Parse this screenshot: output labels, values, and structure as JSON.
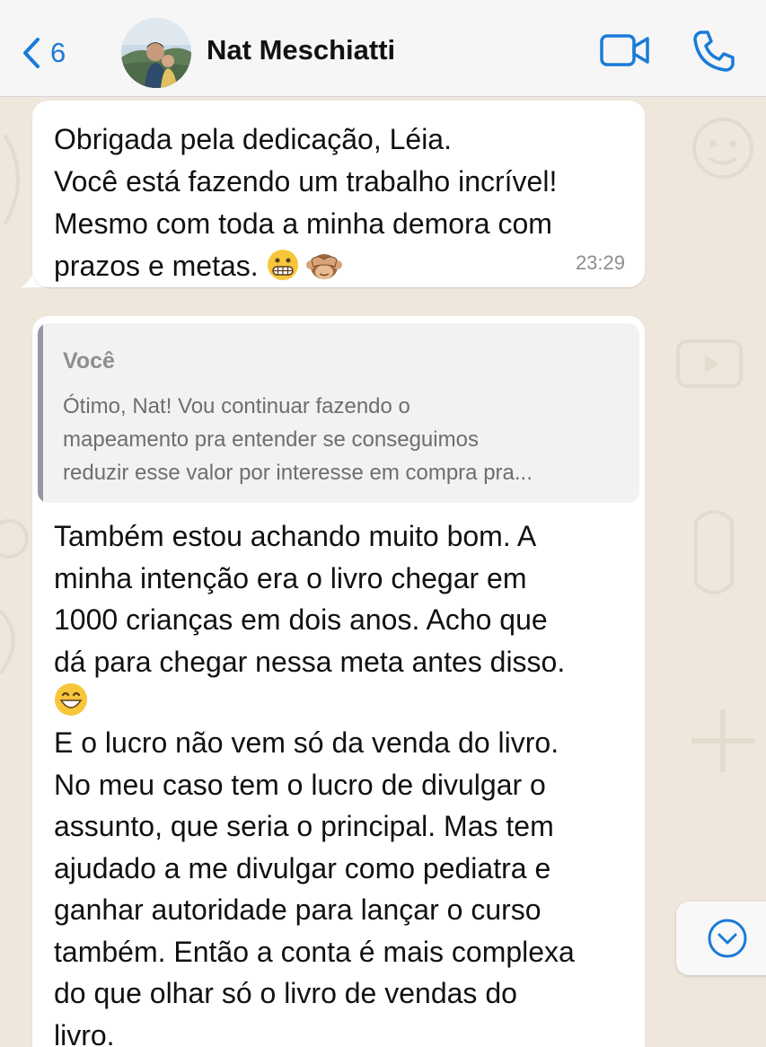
{
  "header": {
    "back_count": "6",
    "contact_name": "Nat Meschiatti"
  },
  "messages": [
    {
      "lines": [
        "Obrigada pela dedicação, Léia.",
        "Você está fazendo um trabalho incrível!",
        "Mesmo com toda a minha demora com",
        "prazos e metas."
      ],
      "emojis": [
        "grimacing-face",
        "see-no-evil-monkey"
      ],
      "time": "23:29"
    },
    {
      "quote": {
        "author": "Você",
        "lines": [
          "Ótimo, Nat! Vou continuar fazendo o",
          "mapeamento pra entender se conseguimos",
          "reduzir esse valor por interesse em compra pra..."
        ]
      },
      "lines": [
        "Também estou achando muito bom. A",
        "minha intenção era o livro chegar em",
        "1000 crianças em dois anos. Acho que",
        "dá para chegar nessa meta antes disso.",
        "E o lucro não vem só da venda do livro.",
        "No meu caso tem o lucro de divulgar o",
        "assunto, que seria o principal. Mas tem",
        "ajudado a me divulgar como pediatra e",
        "ganhar autoridade para lançar o curso",
        "também. Então a conta é mais complexa",
        "do que olhar só o livro de vendas do",
        "livro."
      ],
      "emojis": [
        "grinning-face-with-smiling-eyes"
      ]
    }
  ],
  "colors": {
    "accent": "#1a7bd8",
    "chat_background": "#efe7dc",
    "bubble": "#ffffff",
    "timestamp": "#8d8d8d"
  }
}
